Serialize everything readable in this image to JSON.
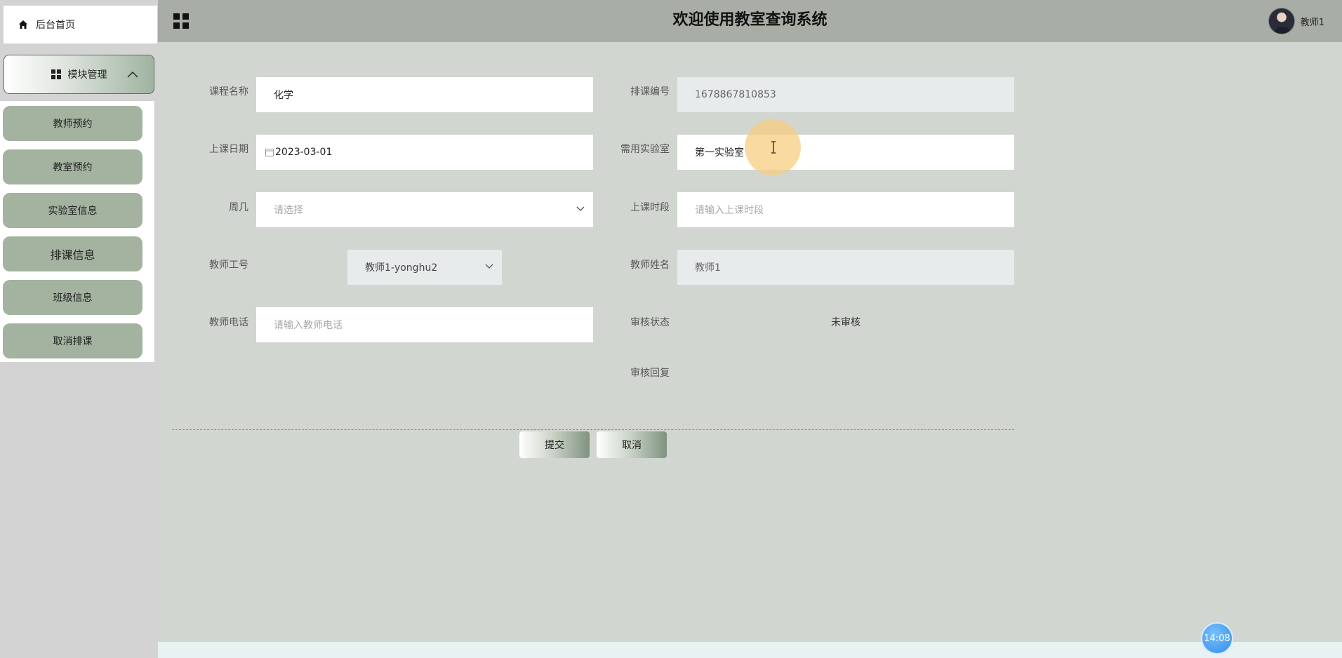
{
  "sidebar": {
    "home_label": "后台首页",
    "module_label": "模块管理",
    "items": [
      {
        "label": "教师预约"
      },
      {
        "label": "教室预约"
      },
      {
        "label": "实验室信息"
      },
      {
        "label": "排课信息"
      },
      {
        "label": "班级信息"
      },
      {
        "label": "取消排课"
      }
    ]
  },
  "header": {
    "title": "欢迎使用教室查询系统",
    "user_name": "教师1"
  },
  "form": {
    "course_name": {
      "label": "课程名称",
      "value": "化学"
    },
    "schedule_no": {
      "label": "排课编号",
      "value": "1678867810853"
    },
    "class_date": {
      "label": "上课日期",
      "value": "2023-03-01"
    },
    "lab_needed": {
      "label": "需用实验室",
      "value": "第一实验室"
    },
    "weekday": {
      "label": "周几",
      "placeholder": "请选择"
    },
    "class_period": {
      "label": "上课时段",
      "placeholder": "请输入上课时段"
    },
    "teacher_id": {
      "label": "教师工号",
      "value": "教师1-yonghu2"
    },
    "teacher_name": {
      "label": "教师姓名",
      "value": "教师1"
    },
    "teacher_phone": {
      "label": "教师电话",
      "placeholder": "请输入教师电话"
    },
    "review_status": {
      "label": "审核状态",
      "value": "未审核"
    },
    "review_reply": {
      "label": "审核回复"
    }
  },
  "buttons": {
    "submit": "提交",
    "cancel": "取消"
  },
  "clock": "14:08",
  "colors": {
    "topbar": "#a8aea6",
    "main_bg": "#d2d6d1",
    "menu_item": "#a3b3a0",
    "divider": "#6d9a94"
  }
}
